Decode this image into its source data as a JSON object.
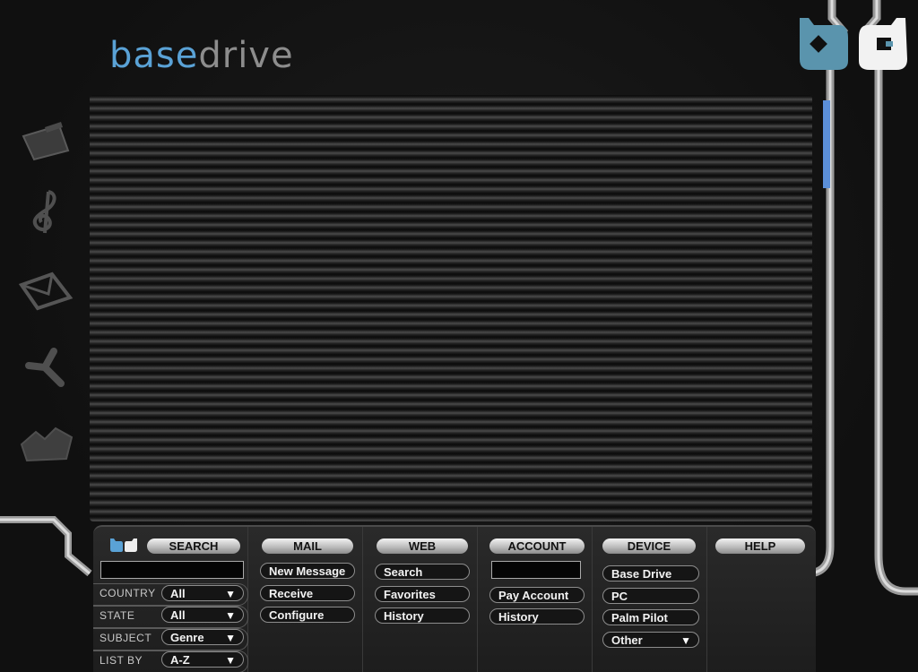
{
  "app": {
    "logo_part1": "base",
    "logo_part2": "drive",
    "accent_color": "#5aa2d6"
  },
  "sidebar": {
    "icons": [
      {
        "name": "clapperboard-icon"
      },
      {
        "name": "treble-clef-icon"
      },
      {
        "name": "envelope-icon"
      },
      {
        "name": "tri-blade-icon"
      },
      {
        "name": "crowd-icon"
      }
    ]
  },
  "panel": {
    "search": {
      "header": "SEARCH",
      "query": "",
      "filters": [
        {
          "label": "COUNTRY",
          "value": "All"
        },
        {
          "label": "STATE",
          "value": "All"
        },
        {
          "label": "SUBJECT",
          "value": "Genre"
        },
        {
          "label": "LIST BY",
          "value": "A-Z"
        }
      ]
    },
    "mail": {
      "header": "MAIL",
      "items": [
        "New Message",
        "Receive",
        "Configure"
      ]
    },
    "web": {
      "header": "WEB",
      "items": [
        "Search",
        "Favorites",
        "History"
      ]
    },
    "account": {
      "header": "ACCOUNT",
      "field_value": "",
      "items": [
        "Pay Account",
        "History"
      ]
    },
    "device": {
      "header": "DEVICE",
      "items": [
        "Base Drive",
        "PC",
        "Palm Pilot"
      ],
      "select_label": "Other"
    },
    "help": {
      "header": "HELP"
    }
  },
  "icons": {
    "dropdown": "chevron-down-icon"
  }
}
